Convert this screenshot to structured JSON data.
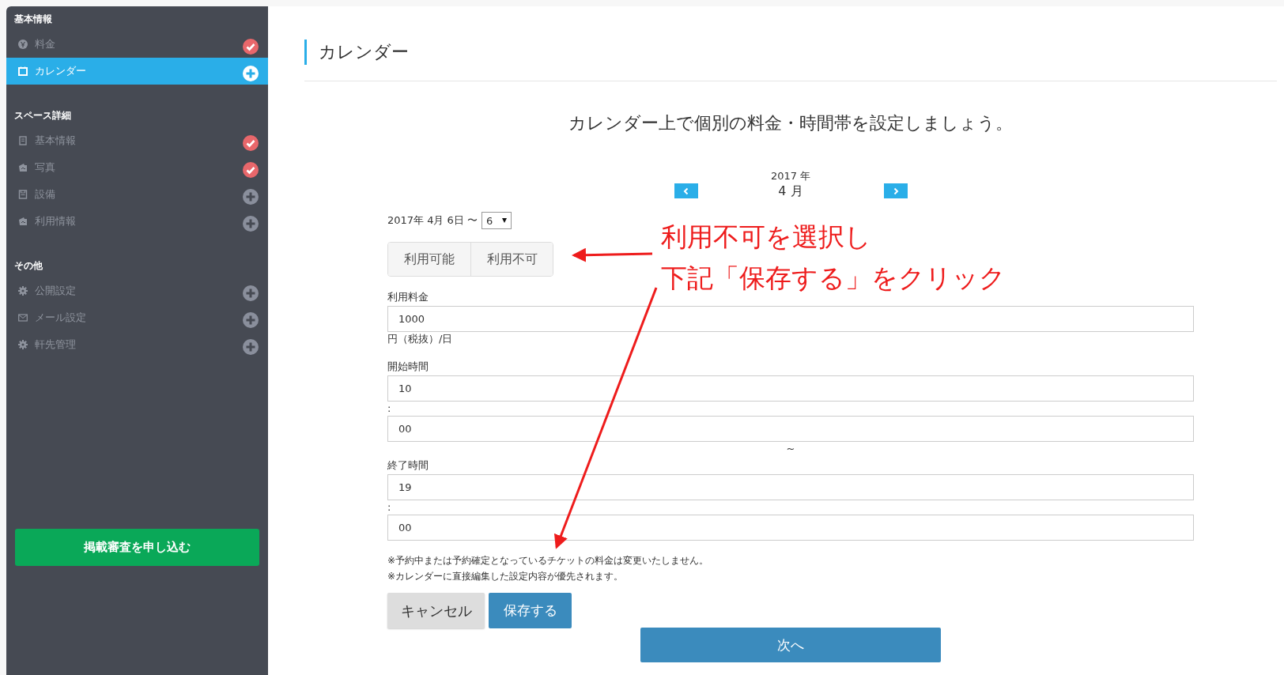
{
  "sidebar": {
    "sections": [
      {
        "title": "基本情報",
        "items": [
          {
            "label": "料金",
            "kind": "done",
            "selected": false
          },
          {
            "label": "カレンダー",
            "kind": "todo",
            "selected": true
          }
        ]
      },
      {
        "title": "スペース詳細",
        "items": [
          {
            "label": "基本情報",
            "kind": "done",
            "selected": false
          },
          {
            "label": "写真",
            "kind": "done",
            "selected": false
          },
          {
            "label": "設備",
            "kind": "todo",
            "selected": false
          },
          {
            "label": "利用情報",
            "kind": "todo",
            "selected": false
          }
        ]
      },
      {
        "title": "その他",
        "items": [
          {
            "label": "公開設定",
            "kind": "todo",
            "selected": false
          },
          {
            "label": "メール設定",
            "kind": "todo",
            "selected": false
          },
          {
            "label": "軒先管理",
            "kind": "todo",
            "selected": false
          }
        ]
      }
    ],
    "submit_button": "掲載審査を申し込む"
  },
  "page_title": "カレンダー",
  "intro": "カレンダー上で個別の料金・時間帯を設定しましょう。",
  "calendar_nav": {
    "year": "2017 年",
    "month": "4 月"
  },
  "date_range": {
    "text": "2017年 4月 6日 〜",
    "end_day": "6"
  },
  "availability": [
    {
      "label": "利用可能",
      "selected": false
    },
    {
      "label": "利用不可",
      "selected": false
    }
  ],
  "fields": [
    {
      "label": "利用料金",
      "value": "1000",
      "suffix": "円（税抜）/日"
    },
    {
      "label": "開始時間",
      "value": "10",
      "suffix": ":"
    },
    {
      "value": "00",
      "suffix": "~"
    },
    {
      "label": "終了時間",
      "value": "19",
      "suffix": ":"
    },
    {
      "value": "00"
    }
  ],
  "notes": [
    "※予約中または予約確定となっているチケットの料金は変更いたしません。",
    "※カレンダーに直接編集した設定内容が優先されます。"
  ],
  "buttons": {
    "cancel": "キャンセル",
    "save": "保存する",
    "next": "次へ"
  },
  "annotation": [
    "利用不可を選択し",
    "下記「保存する」をクリック"
  ]
}
